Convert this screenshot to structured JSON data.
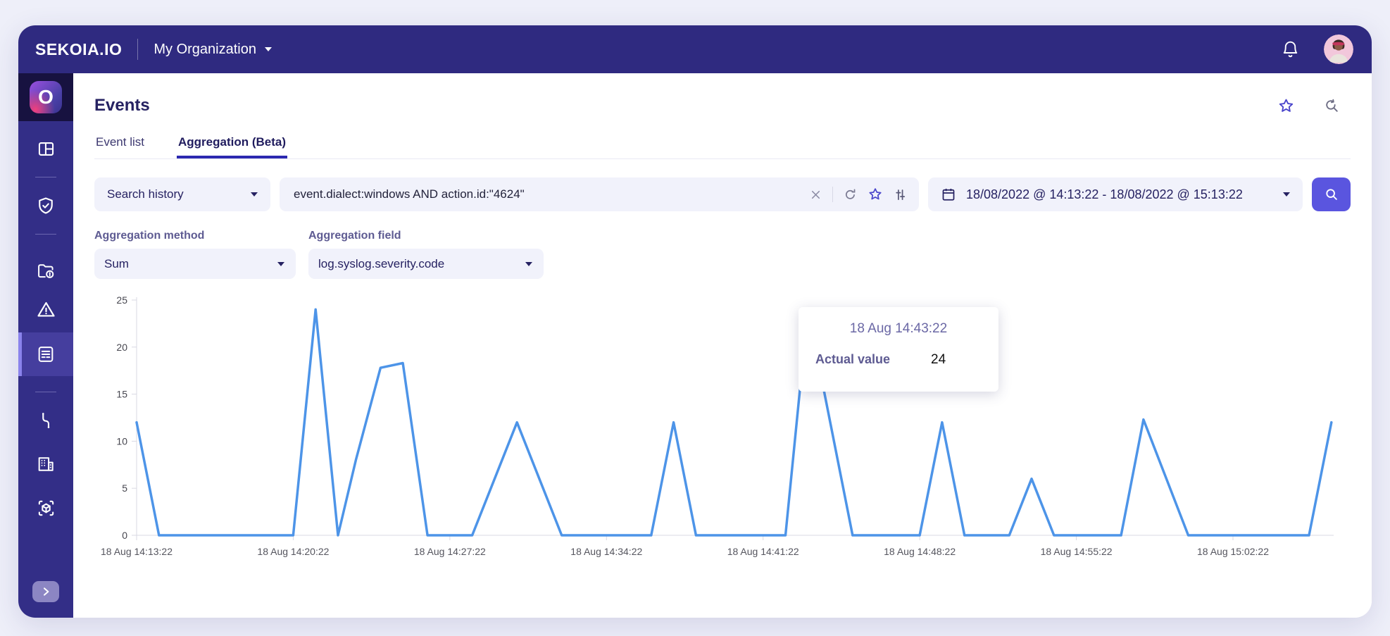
{
  "topbar": {
    "brand": "SEKOIA.IO",
    "organization": "My Organization"
  },
  "page": {
    "title": "Events",
    "tabs": [
      {
        "label": "Event list",
        "active": false
      },
      {
        "label": "Aggregation (Beta)",
        "active": true
      }
    ]
  },
  "search": {
    "history_label": "Search history",
    "query": "event.dialect:windows AND action.id:\"4624\"",
    "date_range": "18/08/2022 @ 14:13:22 - 18/08/2022 @ 15:13:22"
  },
  "aggregation": {
    "method_label": "Aggregation method",
    "method_value": "Sum",
    "field_label": "Aggregation field",
    "field_value": "log.syslog.severity.code"
  },
  "sidebar": {
    "items": [
      "sekoia-logo",
      "dashboard",
      "shield-check",
      "cases-folder",
      "alerts-triangle",
      "events-list (active)",
      "intake-cable",
      "organization-building",
      "asset-cube-scan"
    ],
    "expand": "chevron-right"
  },
  "icons": {
    "topbar": [
      "bell-icon",
      "avatar"
    ],
    "page_header": [
      "star-icon",
      "search-history-icon"
    ],
    "query_box": [
      "clear-x-icon",
      "refresh-icon",
      "star-icon",
      "filters-tune-icon"
    ],
    "date_box": [
      "calendar-icon",
      "caret-down-icon"
    ],
    "search_button": [
      "magnifier-icon"
    ]
  },
  "colors": {
    "topbar_bg": "#2F2A80",
    "sidebar_bg": "#332E87",
    "logo_tile_bg": "#171240",
    "active_item_bg": "#453E9E",
    "active_item_accent": "#8A83EC",
    "control_bg": "#F1F2FB",
    "primary_button": "#5A55DF",
    "tab_underline": "#2B28B0",
    "title_text": "#262262",
    "chart_line": "#4D94E8"
  },
  "chart_data": {
    "type": "line",
    "title": "",
    "xlabel": "",
    "ylabel": "",
    "grid": false,
    "legend": null,
    "ylim": [
      0,
      25
    ],
    "y_ticks": [
      0,
      5,
      10,
      15,
      20,
      25
    ],
    "x_domain_minutes": [
      0,
      53.5
    ],
    "x_tick_minutes": [
      0,
      7,
      14,
      21,
      28,
      35,
      42,
      49
    ],
    "x_tick_labels": [
      "18 Aug 14:13:22",
      "18 Aug 14:20:22",
      "18 Aug 14:27:22",
      "18 Aug 14:34:22",
      "18 Aug 14:41:22",
      "18 Aug 14:48:22",
      "18 Aug 14:55:22",
      "18 Aug 15:02:22"
    ],
    "series": [
      {
        "name": "Actual value",
        "color": "#4D94E8",
        "points_t_v": [
          [
            0,
            12
          ],
          [
            1,
            0
          ],
          [
            7,
            0
          ],
          [
            8,
            24
          ],
          [
            9,
            0
          ],
          [
            9.8,
            8
          ],
          [
            10.9,
            17.8
          ],
          [
            11.9,
            18.3
          ],
          [
            13,
            0
          ],
          [
            15,
            0
          ],
          [
            17,
            12
          ],
          [
            19,
            0
          ],
          [
            23,
            0
          ],
          [
            24,
            12
          ],
          [
            25,
            0
          ],
          [
            29,
            0
          ],
          [
            30,
            24
          ],
          [
            32,
            0
          ],
          [
            35,
            0
          ],
          [
            36,
            12
          ],
          [
            37,
            0
          ],
          [
            39,
            0
          ],
          [
            40,
            6
          ],
          [
            41,
            0
          ],
          [
            44,
            0
          ],
          [
            45,
            12.3
          ],
          [
            47,
            0
          ],
          [
            52.4,
            0
          ],
          [
            53.4,
            12
          ]
        ]
      }
    ],
    "tooltip": {
      "title": "18 Aug 14:43:22",
      "label": "Actual value",
      "value": "24"
    }
  }
}
